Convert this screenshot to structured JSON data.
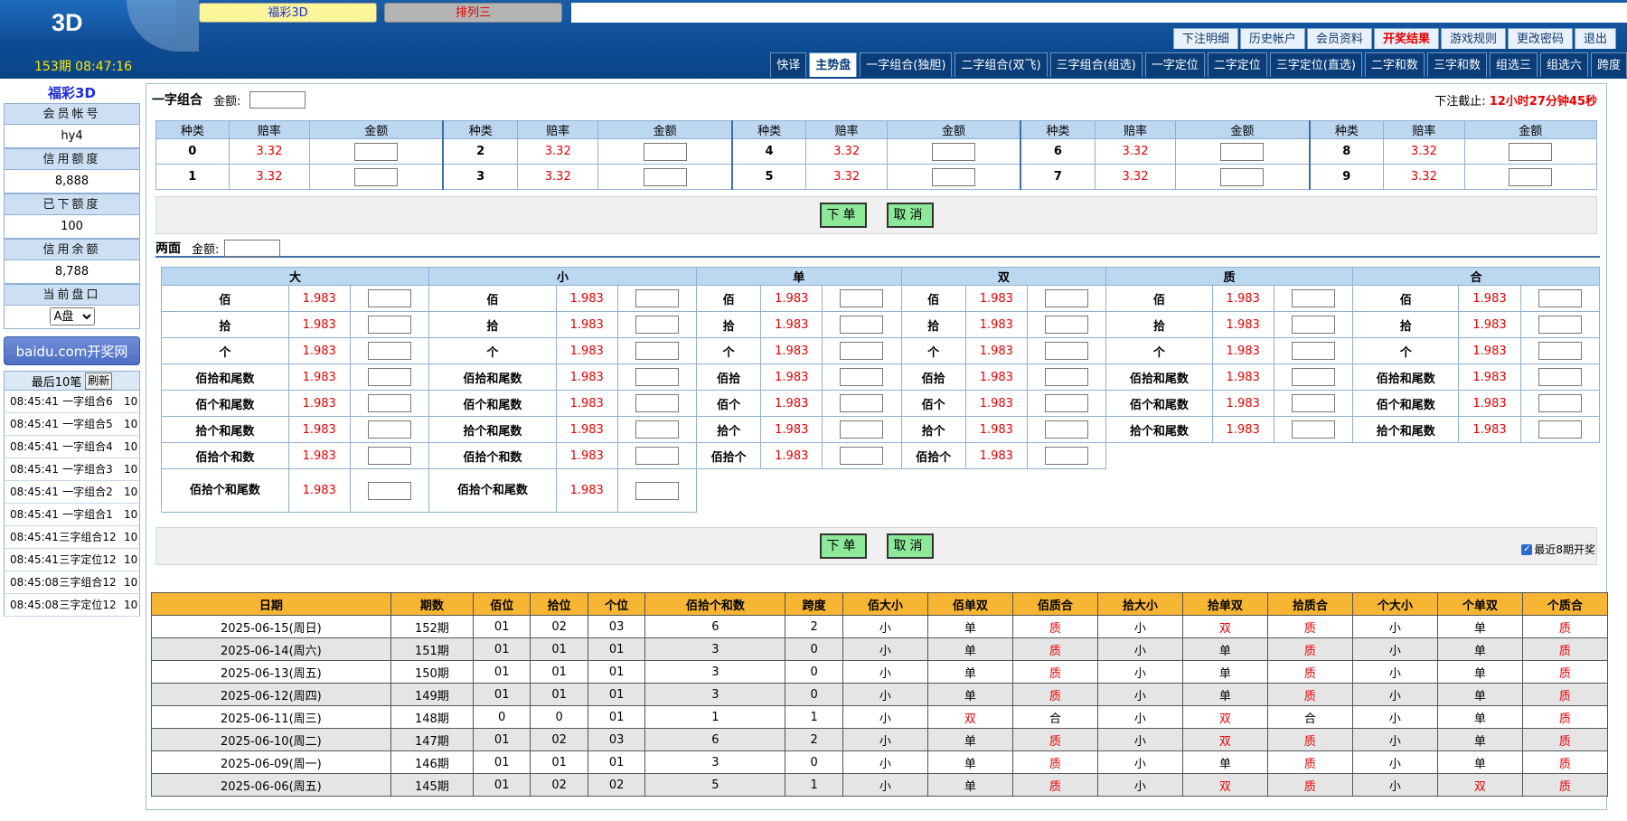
{
  "header": {
    "logo": "3D",
    "period_time": "153期 08:47:16",
    "lottery_tabs": [
      "福彩3D",
      "排列三"
    ],
    "top_nav": [
      "下注明细",
      "历史帐户",
      "会员资料",
      "开奖结果",
      "游戏规则",
      "更改密码",
      "退出"
    ],
    "play_tabs": [
      "快译",
      "主势盘",
      "一字组合(独胆)",
      "二字组合(双飞)",
      "三字组合(组选)",
      "一字定位",
      "二字定位",
      "三字定位(直选)",
      "二字和数",
      "三字和数",
      "组选三",
      "组选六",
      "跨度"
    ]
  },
  "sidebar": {
    "title": "福彩3D",
    "account_label": "会员帐号",
    "account": "hy4",
    "credit_label": "信用额度",
    "credit": "8,888",
    "used_label": "已下额度",
    "used": "100",
    "balance_label": "信用余额",
    "balance": "8,788",
    "pan_label": "当前盘口",
    "pan": "A盘",
    "kaijiang": "baidu.com开奖网",
    "recent_label": "最后10笔",
    "refresh": "刷新",
    "recent": [
      {
        "t": "08:45:41",
        "item": "一字组合6",
        "amt": "10"
      },
      {
        "t": "08:45:41",
        "item": "一字组合5",
        "amt": "10"
      },
      {
        "t": "08:45:41",
        "item": "一字组合4",
        "amt": "10"
      },
      {
        "t": "08:45:41",
        "item": "一字组合3",
        "amt": "10"
      },
      {
        "t": "08:45:41",
        "item": "一字组合2",
        "amt": "10"
      },
      {
        "t": "08:45:41",
        "item": "一字组合1",
        "amt": "10"
      },
      {
        "t": "08:45:41",
        "item": "三字组合12",
        "amt": "10"
      },
      {
        "t": "08:45:41",
        "item": "三字定位12",
        "amt": "10"
      },
      {
        "t": "08:45:08",
        "item": "三字组合12",
        "amt": "10"
      },
      {
        "t": "08:45:08",
        "item": "三字定位12",
        "amt": "10"
      }
    ]
  },
  "section1": {
    "title": "一字组合",
    "amount_label": "金额:",
    "deadline_label": "下注截止:",
    "deadline": "12小时27分钟45秒",
    "headers": [
      "种类",
      "赔率",
      "金额"
    ],
    "rows": [
      [
        {
          "k": "0",
          "o": "3.32"
        },
        {
          "k": "2",
          "o": "3.32"
        },
        {
          "k": "4",
          "o": "3.32"
        },
        {
          "k": "6",
          "o": "3.32"
        },
        {
          "k": "8",
          "o": "3.32"
        }
      ],
      [
        {
          "k": "1",
          "o": "3.32"
        },
        {
          "k": "3",
          "o": "3.32"
        },
        {
          "k": "5",
          "o": "3.32"
        },
        {
          "k": "7",
          "o": "3.32"
        },
        {
          "k": "9",
          "o": "3.32"
        }
      ]
    ]
  },
  "buttons": {
    "submit": "下单",
    "cancel": "取消"
  },
  "section2": {
    "title": "两面",
    "amount_label": "金额:",
    "groups": [
      "大",
      "小",
      "单",
      "双",
      "质",
      "合"
    ],
    "odds": "1.983",
    "rows": [
      [
        "佰",
        "佰",
        "佰",
        "佰",
        "佰",
        "佰"
      ],
      [
        "拾",
        "拾",
        "拾",
        "拾",
        "拾",
        "拾"
      ],
      [
        "个",
        "个",
        "个",
        "个",
        "个",
        "个"
      ],
      [
        "佰拾和尾数",
        "佰拾和尾数",
        "佰拾",
        "佰拾",
        "佰拾和尾数",
        "佰拾和尾数"
      ],
      [
        "佰个和尾数",
        "佰个和尾数",
        "佰个",
        "佰个",
        "佰个和尾数",
        "佰个和尾数"
      ],
      [
        "拾个和尾数",
        "拾个和尾数",
        "拾个",
        "拾个",
        "拾个和尾数",
        "拾个和尾数"
      ],
      [
        "佰拾个和数",
        "佰拾个和数",
        "佰拾个",
        "佰拾个",
        "",
        ""
      ],
      [
        "佰拾个和尾数",
        "佰拾个和尾数",
        "",
        "",
        "",
        ""
      ]
    ],
    "recent8": "最近8期开奖"
  },
  "history": {
    "headers": [
      "日期",
      "期数",
      "佰位",
      "拾位",
      "个位",
      "佰拾个和数",
      "跨度",
      "佰大小",
      "佰单双",
      "佰质合",
      "拾大小",
      "拾单双",
      "拾质合",
      "个大小",
      "个单双",
      "个质合"
    ],
    "rows": [
      [
        "2025-06-15(周日)",
        "152期",
        "01",
        "02",
        "03",
        "6",
        "2",
        "小",
        "单",
        "质",
        "小",
        "双",
        "质",
        "小",
        "单",
        "质"
      ],
      [
        "2025-06-14(周六)",
        "151期",
        "01",
        "01",
        "01",
        "3",
        "0",
        "小",
        "单",
        "质",
        "小",
        "单",
        "质",
        "小",
        "单",
        "质"
      ],
      [
        "2025-06-13(周五)",
        "150期",
        "01",
        "01",
        "01",
        "3",
        "0",
        "小",
        "单",
        "质",
        "小",
        "单",
        "质",
        "小",
        "单",
        "质"
      ],
      [
        "2025-06-12(周四)",
        "149期",
        "01",
        "01",
        "01",
        "3",
        "0",
        "小",
        "单",
        "质",
        "小",
        "单",
        "质",
        "小",
        "单",
        "质"
      ],
      [
        "2025-06-11(周三)",
        "148期",
        "0",
        "0",
        "01",
        "1",
        "1",
        "小",
        "双",
        "合",
        "小",
        "双",
        "合",
        "小",
        "单",
        "质"
      ],
      [
        "2025-06-10(周二)",
        "147期",
        "01",
        "02",
        "03",
        "6",
        "2",
        "小",
        "单",
        "质",
        "小",
        "双",
        "质",
        "小",
        "单",
        "质"
      ],
      [
        "2025-06-09(周一)",
        "146期",
        "01",
        "01",
        "01",
        "3",
        "0",
        "小",
        "单",
        "质",
        "小",
        "单",
        "质",
        "小",
        "单",
        "质"
      ],
      [
        "2025-06-06(周五)",
        "145期",
        "01",
        "02",
        "02",
        "5",
        "1",
        "小",
        "单",
        "质",
        "小",
        "双",
        "质",
        "小",
        "双",
        "质"
      ]
    ]
  }
}
